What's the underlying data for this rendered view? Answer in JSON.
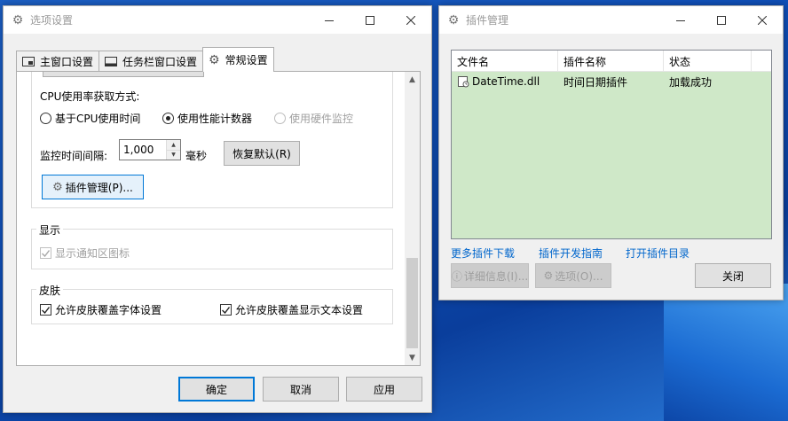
{
  "settings_window": {
    "title": "选项设置",
    "tabs": [
      {
        "label": "主窗口设置"
      },
      {
        "label": "任务栏窗口设置"
      },
      {
        "label": "常规设置"
      }
    ],
    "cpu_label": "CPU使用率获取方式:",
    "radio_cpu_time": "基于CPU使用时间",
    "radio_perf_counter": "使用性能计数器",
    "radio_hw_monitor": "使用硬件监控",
    "interval_label": "监控时间间隔:",
    "interval_value": "1,000",
    "interval_unit": "毫秒",
    "restore_default": "恢复默认(R)",
    "plugin_manage": "插件管理(P)...",
    "display_group": "显示",
    "show_tray_icon": "显示通知区图标",
    "skin_group": "皮肤",
    "allow_skin_font": "允许皮肤覆盖字体设置",
    "allow_skin_text": "允许皮肤覆盖显示文本设置",
    "ok": "确定",
    "cancel": "取消",
    "apply": "应用"
  },
  "plugin_window": {
    "title": "插件管理",
    "columns": [
      "文件名",
      "插件名称",
      "状态"
    ],
    "rows": [
      {
        "file": "DateTime.dll",
        "name": "时间日期插件",
        "status": "加载成功"
      }
    ],
    "link_more": "更多插件下载",
    "link_dev": "插件开发指南",
    "link_open_dir": "打开插件目录",
    "details_btn": "详细信息(I)...",
    "options_btn": "选项(O)...",
    "close_btn": "关闭"
  },
  "colors": {
    "accent": "#0078d7",
    "list_bg": "#cfe8c8",
    "link": "#0066cc"
  }
}
